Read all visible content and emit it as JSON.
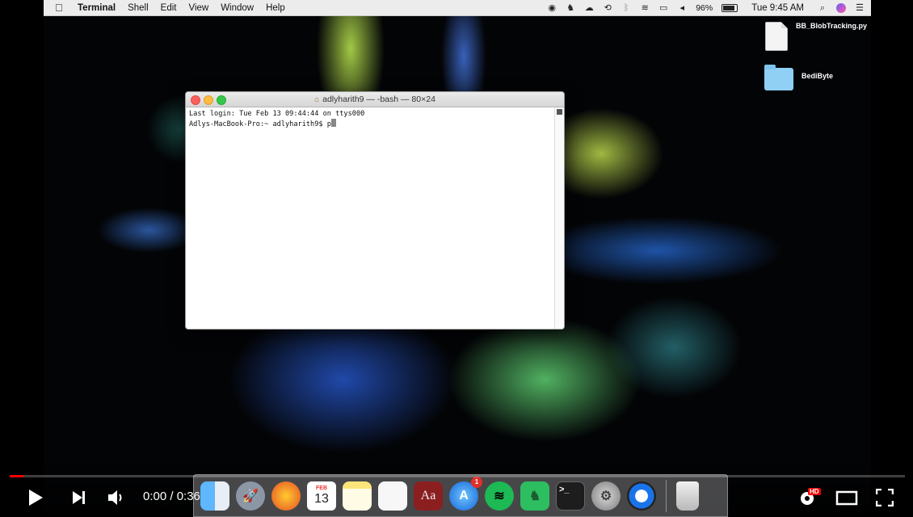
{
  "menubar": {
    "apple": "",
    "app_name": "Terminal",
    "items": [
      "Shell",
      "Edit",
      "View",
      "Window",
      "Help"
    ],
    "battery": "96%",
    "clock": "Tue 9:45 AM"
  },
  "desktop": {
    "file_label": "BB_BlobTracking.py",
    "folder_label": "BediByte"
  },
  "terminal": {
    "title": "adlyharith9 — -bash — 80×24",
    "line1": "Last login: Tue Feb 13 09:44:44 on ttys000",
    "prompt": "Adlys-MacBook-Pro:~ adlyharith9$ p"
  },
  "dock": {
    "calendar_month": "FEB",
    "calendar_day": "13",
    "appstore_badge": "1",
    "dictionary_label": "Aa"
  },
  "player": {
    "time": "0:00 / 0:36",
    "hd_badge": "HD",
    "progress": 0.015,
    "accent": "#ff0000"
  }
}
